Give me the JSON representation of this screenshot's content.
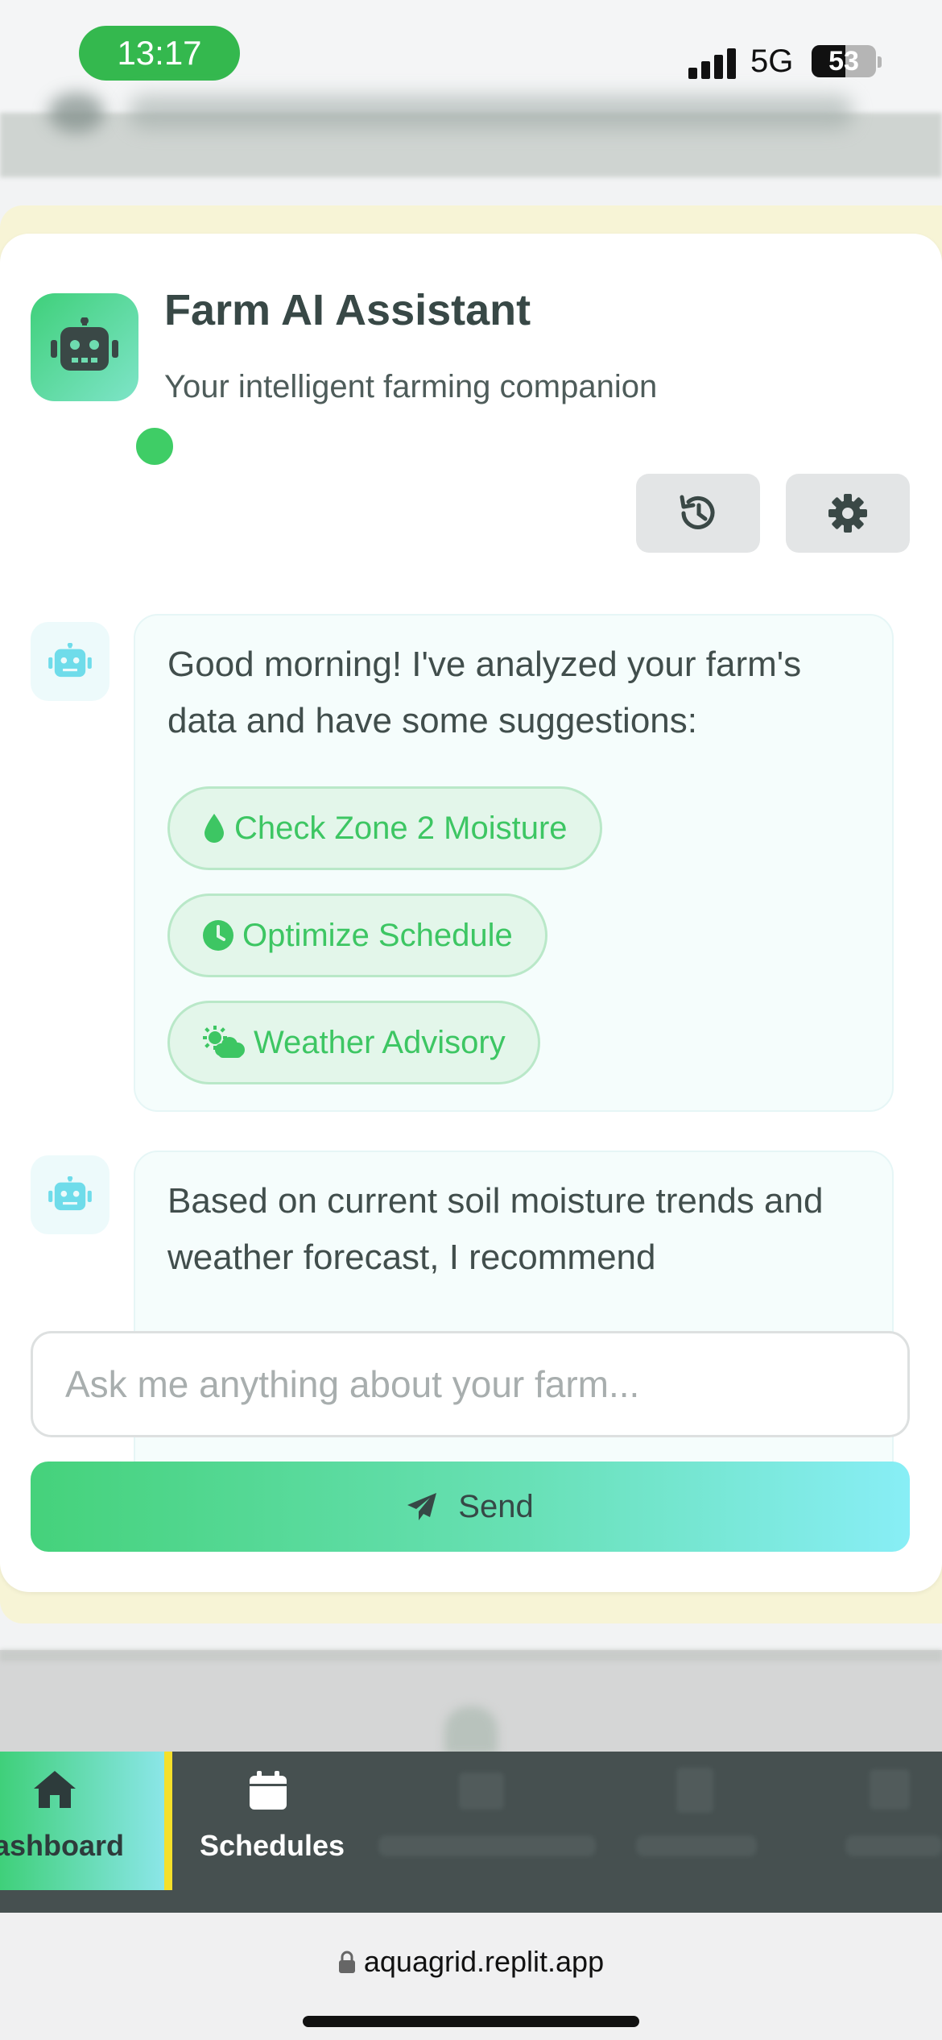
{
  "status_bar": {
    "time": "13:17",
    "network": "5G",
    "battery": "53"
  },
  "assistant": {
    "title": "Farm AI Assistant",
    "subtitle": "Your intelligent farming companion",
    "history_icon": "history-icon",
    "settings_icon": "gear-icon"
  },
  "messages": [
    {
      "text": "Good morning! I've analyzed your farm's data and have some suggestions:",
      "chips": [
        {
          "label": "Check Zone 2 Moisture",
          "icon": "droplet-icon"
        },
        {
          "label": "Optimize Schedule",
          "icon": "clock-icon"
        },
        {
          "label": "Weather Advisory",
          "icon": "sun-cloud-icon"
        }
      ]
    },
    {
      "text": "Based on current soil moisture trends and weather forecast, I recommend"
    }
  ],
  "input": {
    "placeholder": "Ask me anything about your farm..."
  },
  "send_label": "Send",
  "nav": {
    "items": [
      {
        "label": "ashboard",
        "icon": "home-icon",
        "active": true
      },
      {
        "label": "Schedules",
        "icon": "calendar-icon",
        "active": false
      }
    ]
  },
  "browser": {
    "url": "aquagrid.replit.app"
  },
  "colors": {
    "accent": "#3fcd66",
    "nav_bg": "#465050",
    "highlight": "#f5e02a"
  }
}
